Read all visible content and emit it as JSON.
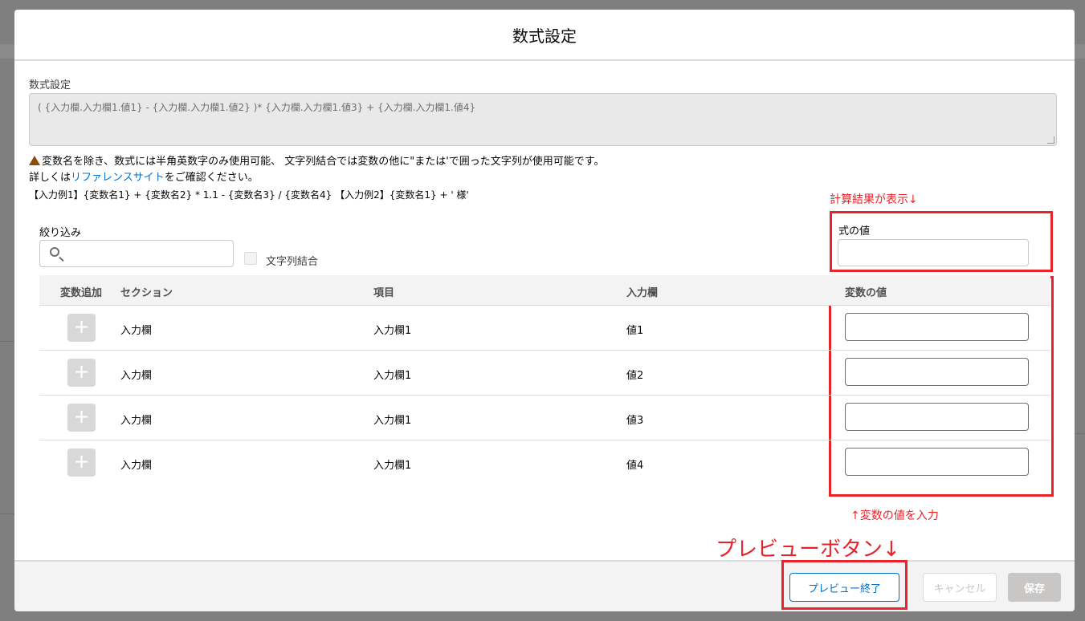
{
  "modal": {
    "title": "数式設定"
  },
  "formula": {
    "label": "数式設定",
    "value": "( {入力欄.入力欄1.値1} - {入力欄.入力欄1.値2} )* {入力欄.入力欄1.値3} + {入力欄.入力欄1.値4}"
  },
  "notes": {
    "line1": "変数名を除き、数式には半角英数字のみ使用可能、 文字列結合では変数の他に\"または'で囲った文字列が使用可能です。",
    "line2_prefix": "詳しくは",
    "line2_link": "リファレンスサイト",
    "line2_suffix": "をご確認ください。",
    "line3": "【入力例1】{変数名1} + {変数名2} * 1.1 - {変数名3} / {変数名4} 【入力例2】{変数名1} + ' 様'"
  },
  "annotations": {
    "result_hint": "計算結果が表示↓",
    "input_hint": "↑変数の値を入力",
    "preview_hint": "プレビューボタン↓",
    "color": "#e8242a"
  },
  "filter": {
    "label": "絞り込み",
    "placeholder": "",
    "value": "",
    "icon": "search-icon"
  },
  "string_concat": {
    "label": "文字列結合",
    "checked": false
  },
  "result": {
    "label": "式の値",
    "value": ""
  },
  "table": {
    "headers": {
      "add": "変数追加",
      "section": "セクション",
      "item": "項目",
      "field": "入力欄",
      "value": "変数の値"
    },
    "rows": [
      {
        "add": "+",
        "section": "入力欄",
        "item": "入力欄1",
        "field": "値1",
        "value": ""
      },
      {
        "add": "+",
        "section": "入力欄",
        "item": "入力欄1",
        "field": "値2",
        "value": ""
      },
      {
        "add": "+",
        "section": "入力欄",
        "item": "入力欄1",
        "field": "値3",
        "value": ""
      },
      {
        "add": "+",
        "section": "入力欄",
        "item": "入力欄1",
        "field": "値4",
        "value": ""
      }
    ]
  },
  "footer": {
    "preview_end": "プレビュー終了",
    "cancel": "キャンセル",
    "save": "保存"
  },
  "colors": {
    "accent": "#0070d2",
    "warning": "#8c4b02"
  }
}
